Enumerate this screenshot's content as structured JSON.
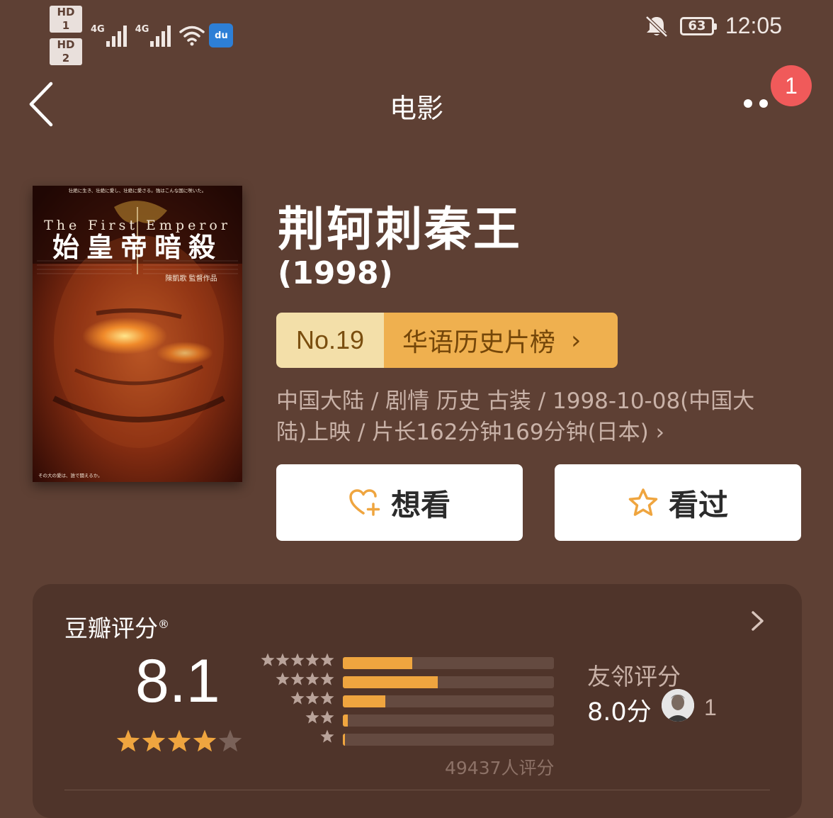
{
  "status_bar": {
    "sim1": "HD 1",
    "sim2": "HD 2",
    "network1": "4G",
    "network2": "4G",
    "baidu_icon_text": "du",
    "battery": "63",
    "time": "12:05"
  },
  "nav": {
    "title": "电影",
    "notification_count": "1"
  },
  "poster": {
    "top_line": "壮絶に生き、壮絶に愛し、壮絶に愛さる。強はこんな国に咲いた。",
    "english_title": "The First Emperor",
    "japanese_title": "始皇帝暗殺",
    "director_line": "陳凱歌 監督作品",
    "bottom_line": "その大の愛は、誰で闘えるか。"
  },
  "movie": {
    "title": "荆轲刺秦王",
    "year": "(1998)",
    "rank_no": "No.19",
    "rank_name": "华语历史片榜",
    "meta_line1": "中国大陆 / 剧情 历史 古装 / 1998-10-08(中国大",
    "meta_line2": "陆)上映 / 片长162分钟169分钟(日本)"
  },
  "actions": {
    "want_label": "想看",
    "seen_label": "看过"
  },
  "rating": {
    "title": "豆瓣评分",
    "registered_mark": "®",
    "score": "8.1",
    "stars_filled": 4,
    "star_distribution": [
      {
        "stars": 5,
        "fraction": 0.33
      },
      {
        "stars": 4,
        "fraction": 0.45
      },
      {
        "stars": 3,
        "fraction": 0.2
      },
      {
        "stars": 2,
        "fraction": 0.025
      },
      {
        "stars": 1,
        "fraction": 0.01
      }
    ],
    "total_ratings": "49437人评分",
    "friend_title": "友邻评分",
    "friend_score": "8.0分",
    "friend_count": "1"
  },
  "colors": {
    "background": "#5e4034",
    "card": "#4f342a",
    "accent_orange": "#efa53f",
    "rank_light": "#f3dfa9",
    "rank_dark": "#efb04f",
    "badge_red": "#f05a5a"
  },
  "icons": {
    "back": "chevron-left-icon",
    "more": "more-dots-icon",
    "want": "heart-plus-icon",
    "seen": "star-outline-icon",
    "mute": "bell-off-icon",
    "wifi": "wifi-icon"
  }
}
